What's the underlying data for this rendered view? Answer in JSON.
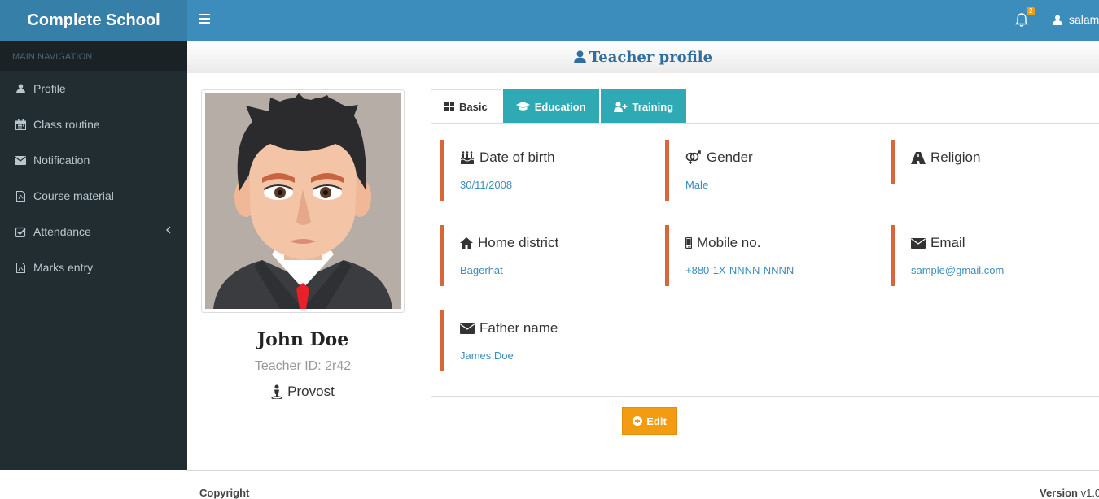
{
  "app": {
    "title": "Complete School"
  },
  "header": {
    "notification_count": "2",
    "username": "salam"
  },
  "sidebar": {
    "header": "MAIN NAVIGATION",
    "items": [
      {
        "label": "Profile",
        "icon": "user-icon"
      },
      {
        "label": "Class routine",
        "icon": "calendar-icon"
      },
      {
        "label": "Notification",
        "icon": "envelope-icon"
      },
      {
        "label": "Course material",
        "icon": "file-pdf-icon"
      },
      {
        "label": "Attendance",
        "icon": "check-square-icon"
      },
      {
        "label": "Marks entry",
        "icon": "file-pdf-icon"
      }
    ]
  },
  "page": {
    "title": "Teacher profile"
  },
  "profile": {
    "name": "John Doe",
    "teacher_id": "Teacher ID: 2r42",
    "role": "Provost"
  },
  "tabs": [
    {
      "label": "Basic",
      "icon": "th-large-icon"
    },
    {
      "label": "Education",
      "icon": "graduation-cap-icon"
    },
    {
      "label": "Training",
      "icon": "user-plus-icon"
    }
  ],
  "fields": {
    "dob": {
      "label": "Date of birth",
      "value": "30/11/2008"
    },
    "gender": {
      "label": "Gender",
      "value": "Male"
    },
    "religion": {
      "label": "Religion",
      "value": ""
    },
    "home_district": {
      "label": "Home district",
      "value": "Bagerhat"
    },
    "mobile": {
      "label": "Mobile no.",
      "value": "+880-1X-NNNN-NNNN"
    },
    "email": {
      "label": "Email",
      "value": "sample@gmail.com"
    },
    "father": {
      "label": "Father name",
      "value": "James Doe"
    }
  },
  "actions": {
    "edit_label": "Edit"
  },
  "footer": {
    "copyright": "Copyright",
    "version_label": "Version",
    "version_value": "v1.0"
  },
  "colors": {
    "header": "#3c8dbc",
    "logo": "#367fa9",
    "sidebar": "#222d32",
    "accent": "#d9653b",
    "teal": "#2fa9b4",
    "warning": "#f39c12"
  }
}
